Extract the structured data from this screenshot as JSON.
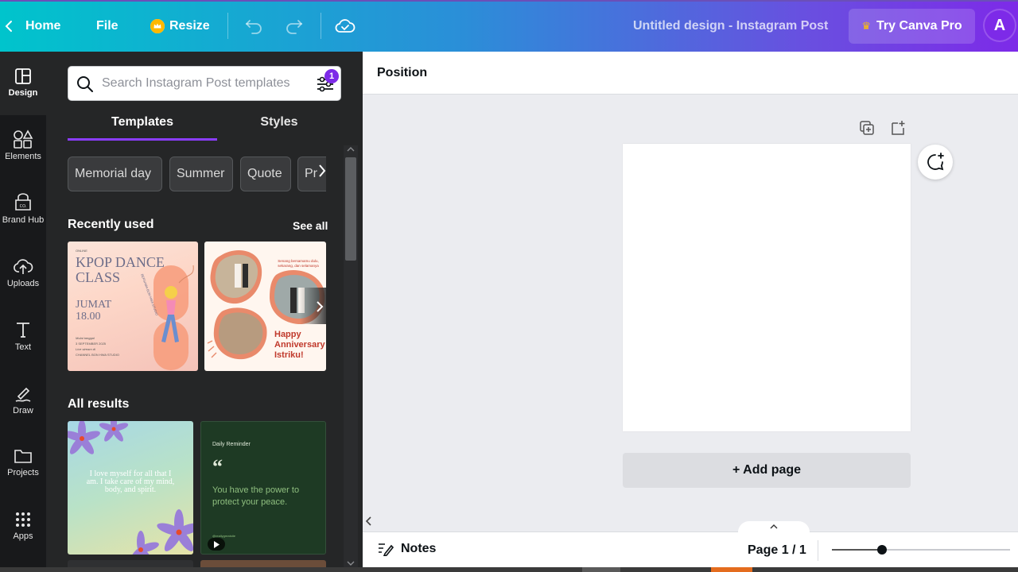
{
  "topbar": {
    "home": "Home",
    "file": "File",
    "resize": "Resize",
    "title": "Untitled design - Instagram Post",
    "try_pro": "Try Canva Pro",
    "avatar_letter": "A"
  },
  "rail": {
    "items": [
      {
        "label": "Design"
      },
      {
        "label": "Elements"
      },
      {
        "label": "Brand Hub"
      },
      {
        "label": "Uploads"
      },
      {
        "label": "Text"
      },
      {
        "label": "Draw"
      },
      {
        "label": "Projects"
      },
      {
        "label": "Apps"
      }
    ]
  },
  "panel": {
    "search_placeholder": "Search Instagram Post templates",
    "filter_badge": "1",
    "tabs": [
      {
        "label": "Templates"
      },
      {
        "label": "Styles"
      }
    ],
    "chips": [
      {
        "label": "Memorial day"
      },
      {
        "label": "Summer"
      },
      {
        "label": "Quote"
      },
      {
        "label": "Pr"
      }
    ],
    "recently_used": "Recently used",
    "see_all": "See all",
    "all_results": "All results",
    "thumbs": {
      "kpop": {
        "small": "ONLINE",
        "title": "KPOP DANCE CLASS",
        "day": "JUMAT",
        "time": "18.00",
        "side": "BERSAMA BON HWA STUDIO",
        "date_label": "Mulai tanggal",
        "date": "3 SEPTEMBER 2025",
        "live": "Live stream di",
        "channel": "CHANNEL BON HWA STUDIO"
      },
      "anniv": {
        "caption": "Senang bersamamu dulu, sekarang, dan selamanya",
        "line1": "Happy",
        "line2": "Anniversary",
        "line3": "Istriku!"
      },
      "love": {
        "text": "I love myself for all that I am. I take care of my mind, body, and spirit."
      },
      "reminder": {
        "label": "Daily Reminder",
        "quote_mark": "“",
        "text": "You have the power to protect your peace.",
        "handle": "@reallygreatsite"
      }
    }
  },
  "editor": {
    "position": "Position",
    "add_page": "+ Add page",
    "notes": "Notes",
    "page_indicator": "Page 1 / 1",
    "zoom_level": 0.28
  }
}
